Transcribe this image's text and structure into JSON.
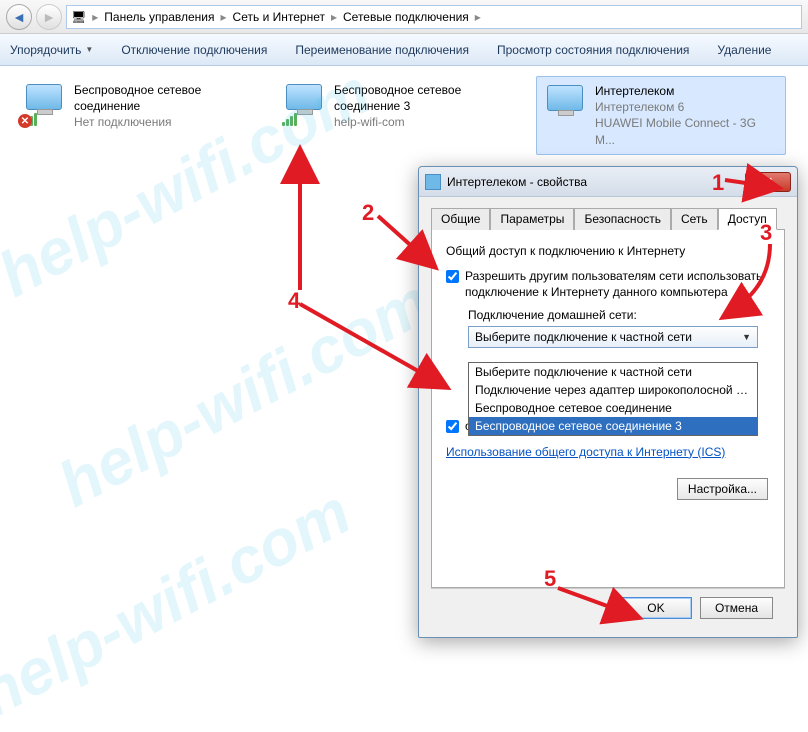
{
  "breadcrumb": {
    "part1": "Панель управления",
    "part2": "Сеть и Интернет",
    "part3": "Сетевые подключения"
  },
  "toolbar": {
    "organize": "Упорядочить",
    "disable": "Отключение подключения",
    "rename": "Переименование подключения",
    "status": "Просмотр состояния подключения",
    "delete": "Удаление"
  },
  "connections": [
    {
      "title": "Беспроводное сетевое соединение",
      "subtitle": "Нет подключения",
      "status": "disconnected"
    },
    {
      "title": "Беспроводное сетевое соединение 3",
      "subtitle": "help-wifi-com",
      "status": "connected"
    },
    {
      "title": "Интертелеком",
      "line2": "Интертелеком 6",
      "line3": "HUAWEI Mobile Connect - 3G M...",
      "status": "selected"
    }
  ],
  "dialog": {
    "title": "Интертелеком - свойства",
    "tabs": {
      "general": "Общие",
      "params": "Параметры",
      "security": "Безопасность",
      "network": "Сеть",
      "access": "Доступ"
    },
    "section_header": "Общий доступ к подключению к Интернету",
    "allow_checkbox": "Разрешить другим пользователям сети использовать подключение к Интернету данного компьютера",
    "home_net_label": "Подключение домашней сети:",
    "combo_selected": "Выберите подключение к частной сети",
    "options": [
      "Выберите подключение к частной сети",
      "Подключение через адаптер широкополосной мобильн",
      "Беспроводное сетевое соединение",
      "Беспроводное сетевое соединение 3"
    ],
    "control_checkbox_tail": "общим доступом к подключению к Интернету",
    "ics_link": "Использование общего доступа к Интернету (ICS)",
    "settings_btn": "Настройка...",
    "ok": "OK",
    "cancel": "Отмена"
  },
  "annotations": {
    "n1": "1",
    "n2": "2",
    "n3": "3",
    "n4": "4",
    "n5": "5"
  },
  "watermark": "help-wifi.com"
}
